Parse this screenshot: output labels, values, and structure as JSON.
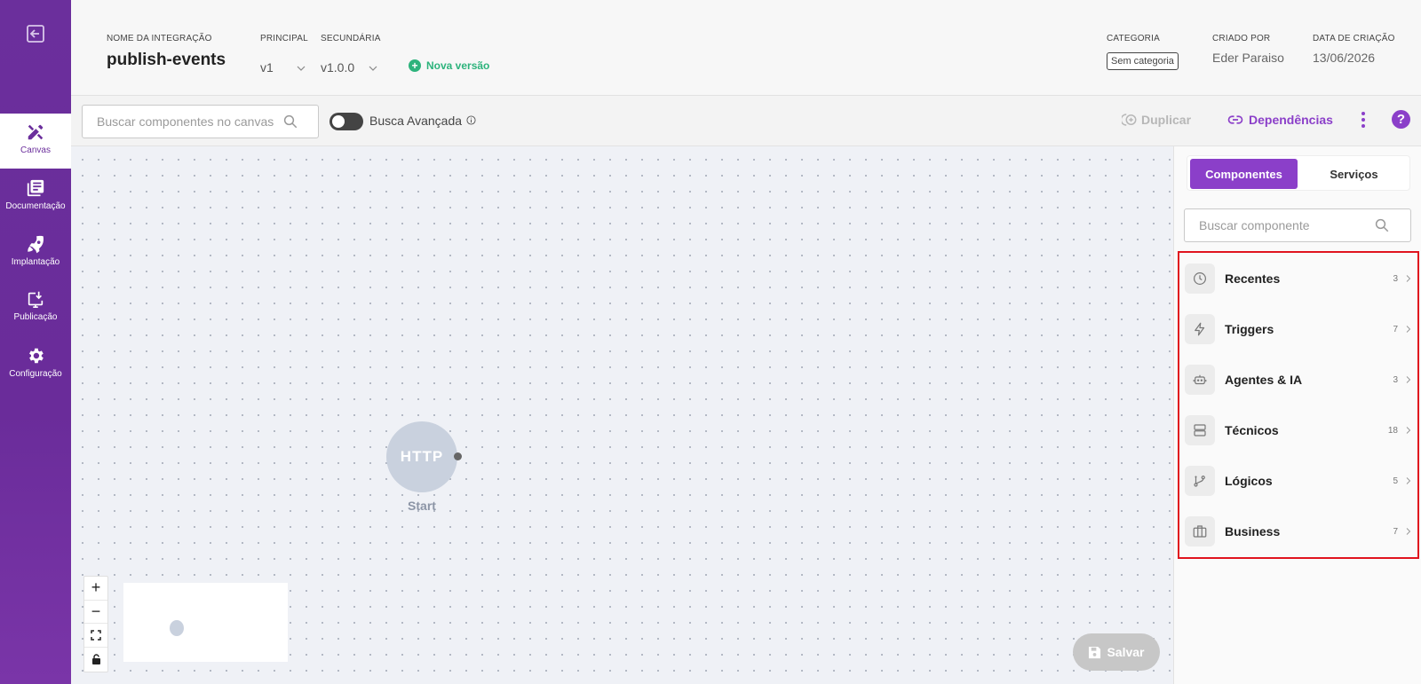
{
  "sidebar": {
    "back_icon": "exit-icon",
    "items": [
      {
        "label": "Canvas",
        "icon": "canvas-tools-icon",
        "active": true
      },
      {
        "label": "Documentação",
        "icon": "documentation-icon",
        "active": false
      },
      {
        "label": "Implantação",
        "icon": "rocket-icon",
        "active": false
      },
      {
        "label": "Publicação",
        "icon": "publish-icon",
        "active": false
      },
      {
        "label": "Configuração",
        "icon": "gear-icon",
        "active": false
      }
    ]
  },
  "header": {
    "integration_label": "NOME DA INTEGRAÇÃO",
    "integration_name": "publish-events",
    "principal_label": "PRINCIPAL",
    "principal_value": "v1",
    "secondary_label": "SECUNDÁRIA",
    "secondary_value": "v1.0.0",
    "new_version": "Nova versão",
    "category_label": "CATEGORIA",
    "category_value": "Sem categoria",
    "created_by_label": "CRIADO POR",
    "created_by_value": "Eder Paraiso",
    "created_date_label": "DATA DE CRIAÇÃO",
    "created_date_value": "13/06/2026"
  },
  "toolbar": {
    "search_placeholder": "Buscar componentes no canvas",
    "advanced_search_label": "Busca Avançada",
    "advanced_search_on": false,
    "duplicate_label": "Duplicar",
    "dependencies_label": "Dependências",
    "help_label": "?"
  },
  "canvas": {
    "node": {
      "label": "HTTP",
      "caption": "Start"
    },
    "zoom_controls": [
      "+",
      "−",
      "fit-view-icon",
      "lock-icon"
    ],
    "save_label": "Salvar"
  },
  "panel": {
    "tabs": [
      {
        "label": "Componentes",
        "active": true
      },
      {
        "label": "Serviços",
        "active": false
      }
    ],
    "search_placeholder": "Buscar componente",
    "categories": [
      {
        "name": "Recentes",
        "count": "3",
        "icon": "clock-icon"
      },
      {
        "name": "Triggers",
        "count": "7",
        "icon": "lightning-icon"
      },
      {
        "name": "Agentes & IA",
        "count": "3",
        "icon": "robot-icon"
      },
      {
        "name": "Técnicos",
        "count": "18",
        "icon": "server-icon"
      },
      {
        "name": "Lógicos",
        "count": "5",
        "icon": "git-branch-icon"
      },
      {
        "name": "Business",
        "count": "7",
        "icon": "briefcase-icon"
      }
    ]
  },
  "colors": {
    "primary": "#8b3fc9",
    "sidebar": "#6b2f9c",
    "success": "#2db37c",
    "highlight_border": "#e0141e"
  }
}
